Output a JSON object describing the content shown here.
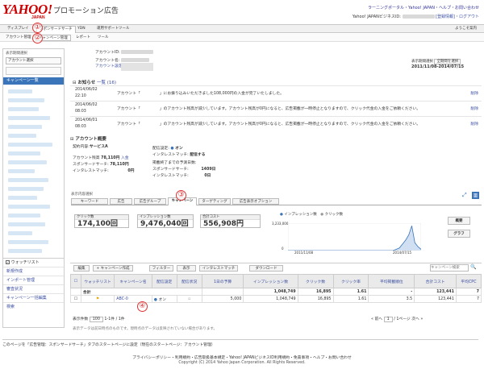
{
  "brand": {
    "logo": "YAHOO!",
    "logo_sub": "JAPAN",
    "product": "プロモーション広告"
  },
  "header": {
    "top_links": "ラーニングポータル・Yahoo! JAPAN・ヘルプ・お問い合わせ",
    "user_line": "Yahoo! JAPANビジネスID:",
    "user_links": "[登録情報]・ログアウト"
  },
  "tabs": [
    {
      "label": "ディスプレイ"
    },
    {
      "label": "スポンサードサーチ"
    },
    {
      "label": "YDN"
    },
    {
      "label": "運用サポートツール"
    }
  ],
  "tabs_right": "ようこそ案内",
  "subtabs": [
    {
      "label": "アカウント管理"
    },
    {
      "label": "キャンペーン管理"
    },
    {
      "label": "レポート"
    },
    {
      "label": "ツール"
    }
  ],
  "callouts": [
    "①",
    "②",
    "③",
    "④"
  ],
  "sidebar": {
    "head": "表示期間選択",
    "select": "アカウント選択",
    "blue": "キャンペーン一覧",
    "watchlist": "ウォッチリスト",
    "items": [
      "新規作成",
      "インポート管理",
      "審査状況",
      "キャンペーン一括編集",
      "検索"
    ]
  },
  "account": {
    "id_label": "アカウントID:",
    "name_label": "アカウント名:",
    "settings_link": "アカウント設定情報",
    "period_label": "表示期間選択",
    "period_select": "全期間を選択",
    "period": "2011/11/08-2014/07/15"
  },
  "news": {
    "title": "お知らせ",
    "link": "一覧",
    "count": "(16)",
    "rows": [
      {
        "date": "2014/06/02",
        "time": "22:10",
        "text": "アカウント「　　　　　」にお振り込みいただきました108,000円の入金が完了いたしました。",
        "action": "削除"
      },
      {
        "date": "2014/06/02",
        "time": "08:03",
        "text": "アカウント「　　　　　」のアカウント残高が減少しています。アカウント残高が0円になると、広告掲載が一時停止となりますので、クリック代金の入金をご依頼ください。",
        "action": "削除"
      },
      {
        "date": "2014/06/01",
        "time": "08:03",
        "text": "アカウント「　　　　　」のアカウント残高が減少しています。アカウント残高が0円になると、広告掲載が一時停止となりますので、クリック代金の入金をご依頼ください。",
        "action": "削除"
      }
    ]
  },
  "overview": {
    "title": "アカウント概要",
    "service_label": "契約内容:",
    "service": "サービスA",
    "balance_label": "アカウント残高",
    "balance": "78,110円",
    "deposit": "入金",
    "ss_label": "スポンサードサーチ:",
    "ss": "78,110円",
    "interest_label": "インタレストマッチ:",
    "interest": "0円",
    "delivery_label": "配信設定:",
    "delivery": "オン",
    "interest_on_label": "インタレストマッチ:",
    "interest_on": "配信する",
    "limit_label": "掲載終了までの予測日数:",
    "ss2_label": "スポンサードサーチ:",
    "ss2": "1409日",
    "im2_label": "インタレストマッチ:",
    "im2": "0日"
  },
  "view_tabs": {
    "label": "表示内容選択",
    "items": [
      "キーワード",
      "広告",
      "広告グループ",
      "キャンペーン",
      "ターゲティング",
      "広告表示オプション"
    ]
  },
  "metrics": [
    {
      "label": "クリック数",
      "value": "174,100回"
    },
    {
      "label": "インプレッション数",
      "value": "9,476,040回"
    },
    {
      "label": "合計コスト",
      "value": "556,908円"
    }
  ],
  "chart": {
    "legend_impressions": "インプレッション数",
    "legend_clicks": "クリック数",
    "y_label": "3,233,000",
    "y_zero": "0",
    "x_start": "2011/11/08",
    "x_end": "2014/07/15",
    "btn_summary": "概要",
    "btn_graph": "グラフ",
    "impressions_series": [
      0,
      0,
      0,
      0,
      0,
      0,
      0,
      0,
      0,
      0,
      0,
      0,
      0,
      0,
      0,
      0,
      0,
      0,
      0,
      0,
      0,
      0,
      0,
      0,
      0,
      0,
      0,
      0,
      0,
      0,
      0,
      0,
      0,
      0,
      0,
      0.05,
      0.1,
      0.25,
      0.4,
      0.6,
      0.95,
      0.3,
      0.15,
      0.05
    ]
  },
  "toolbar": {
    "edit": "編集",
    "create": "キャンペーン作成",
    "filter": "フィルター",
    "display": "表示",
    "interest": "インタレストマッチ",
    "download": "ダウンロード",
    "search_placeholder": "キャンペーン検索"
  },
  "table": {
    "headers": [
      "ウォッチリスト",
      "キャンペーン名",
      "配信設定",
      "配信状況",
      "1日の予算",
      "インプレッション数",
      "クリック数",
      "クリック率",
      "平均掲載順位",
      "合計コスト",
      "平均CPC"
    ],
    "total": {
      "label": "合計",
      "impressions": "1,048,749",
      "clicks": "16,895",
      "ctr": "1.61",
      "position": "-",
      "cost": "123,441",
      "cpc": "7"
    },
    "row": {
      "name": "ABC-0",
      "status": "オン",
      "budget": "5,000",
      "impressions": "1,048,749",
      "clicks": "16,895",
      "ctr": "1.61",
      "position": "3.5",
      "cost": "123,441",
      "cpc": "7"
    }
  },
  "pager": {
    "label": "表示件数",
    "per_page": "100",
    "range": "1-1件",
    "of": "/ 1件",
    "prev": "« 前へ",
    "page": "1",
    "total": "/ 1ページ",
    "next": "次へ »"
  },
  "note": "表示データは前日時点のものです。現時点のデータは反映されていない場合があります。",
  "footer": {
    "note": "このページを「広告管理：スポンサードサーチ」タブのスタートページに設定（現在のスタートページ：アカウント管理）",
    "links": "プライバシーポリシー・利用規約・広告取扱基本規定・Yahoo! JAPANビジネスID利用規約・免責事項・ヘルプ・お問い合わせ",
    "copyright": "Copyright (C) 2014 Yahoo Japan Corporation. All Rights Reserved."
  }
}
